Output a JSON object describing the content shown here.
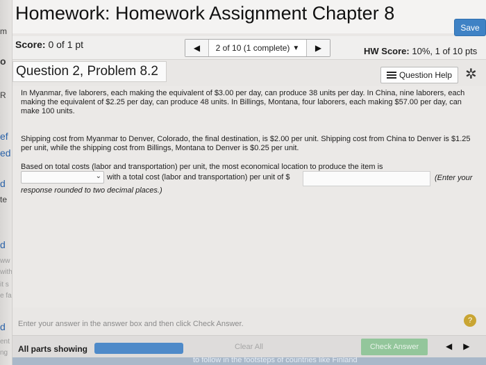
{
  "header": {
    "title": "Homework: Homework Assignment Chapter 8",
    "save_label": "Save"
  },
  "score_bar": {
    "score_label": "Score:",
    "score_value": "0 of 1 pt",
    "pager_text": "2 of 10 (1 complete)",
    "hw_score_label": "HW Score:",
    "hw_score_value": "10%, 1 of 10 pts"
  },
  "question": {
    "title": "Question 2, Problem 8.2",
    "help_label": "Question Help",
    "paragraph1": "In Myanmar, five laborers, each making the equivalent of $3.00 per day, can produce 38 units per day. In China, nine laborers, each making the equivalent of $2.25 per day, can produce 48 units. In Billings, Montana, four laborers, each making $57.00 per day, can make 100 units.",
    "paragraph2": "Shipping cost from Myanmar to Denver, Colorado, the final destination, is $2.00 per unit. Shipping cost from China to Denver is $1.25 per unit, while the shipping cost from Billings, Montana to Denver is $0.25 per unit.",
    "paragraph3": "Based on total costs (labor and transportation) per unit, the most economical location to produce the item is",
    "answer_mid": "with a total cost (labor and transportation) per unit of $",
    "enter_note": "(Enter your",
    "note_cont": "response rounded to two decimal places.)",
    "location_value": "",
    "cost_value": ""
  },
  "status": {
    "instruction": "Enter your answer in the answer box and then click Check Answer."
  },
  "bottom": {
    "parts_label": "All parts showing",
    "progress_fraction": 1.0,
    "clear_label": "Clear All",
    "check_label": "Check Answer"
  },
  "left_strip": [
    "m",
    "o",
    "R",
    "ef",
    "ed",
    "d",
    "te",
    "d",
    "ww",
    "with",
    "it s",
    "e fa",
    "d",
    "ent",
    "ng"
  ],
  "footer": {
    "text": "to follow in the footsteps of countries like Finland"
  },
  "colors": {
    "save_bg": "#3f82c5",
    "check_bg": "#93c69b",
    "progress_fill": "#4e8ac9"
  }
}
